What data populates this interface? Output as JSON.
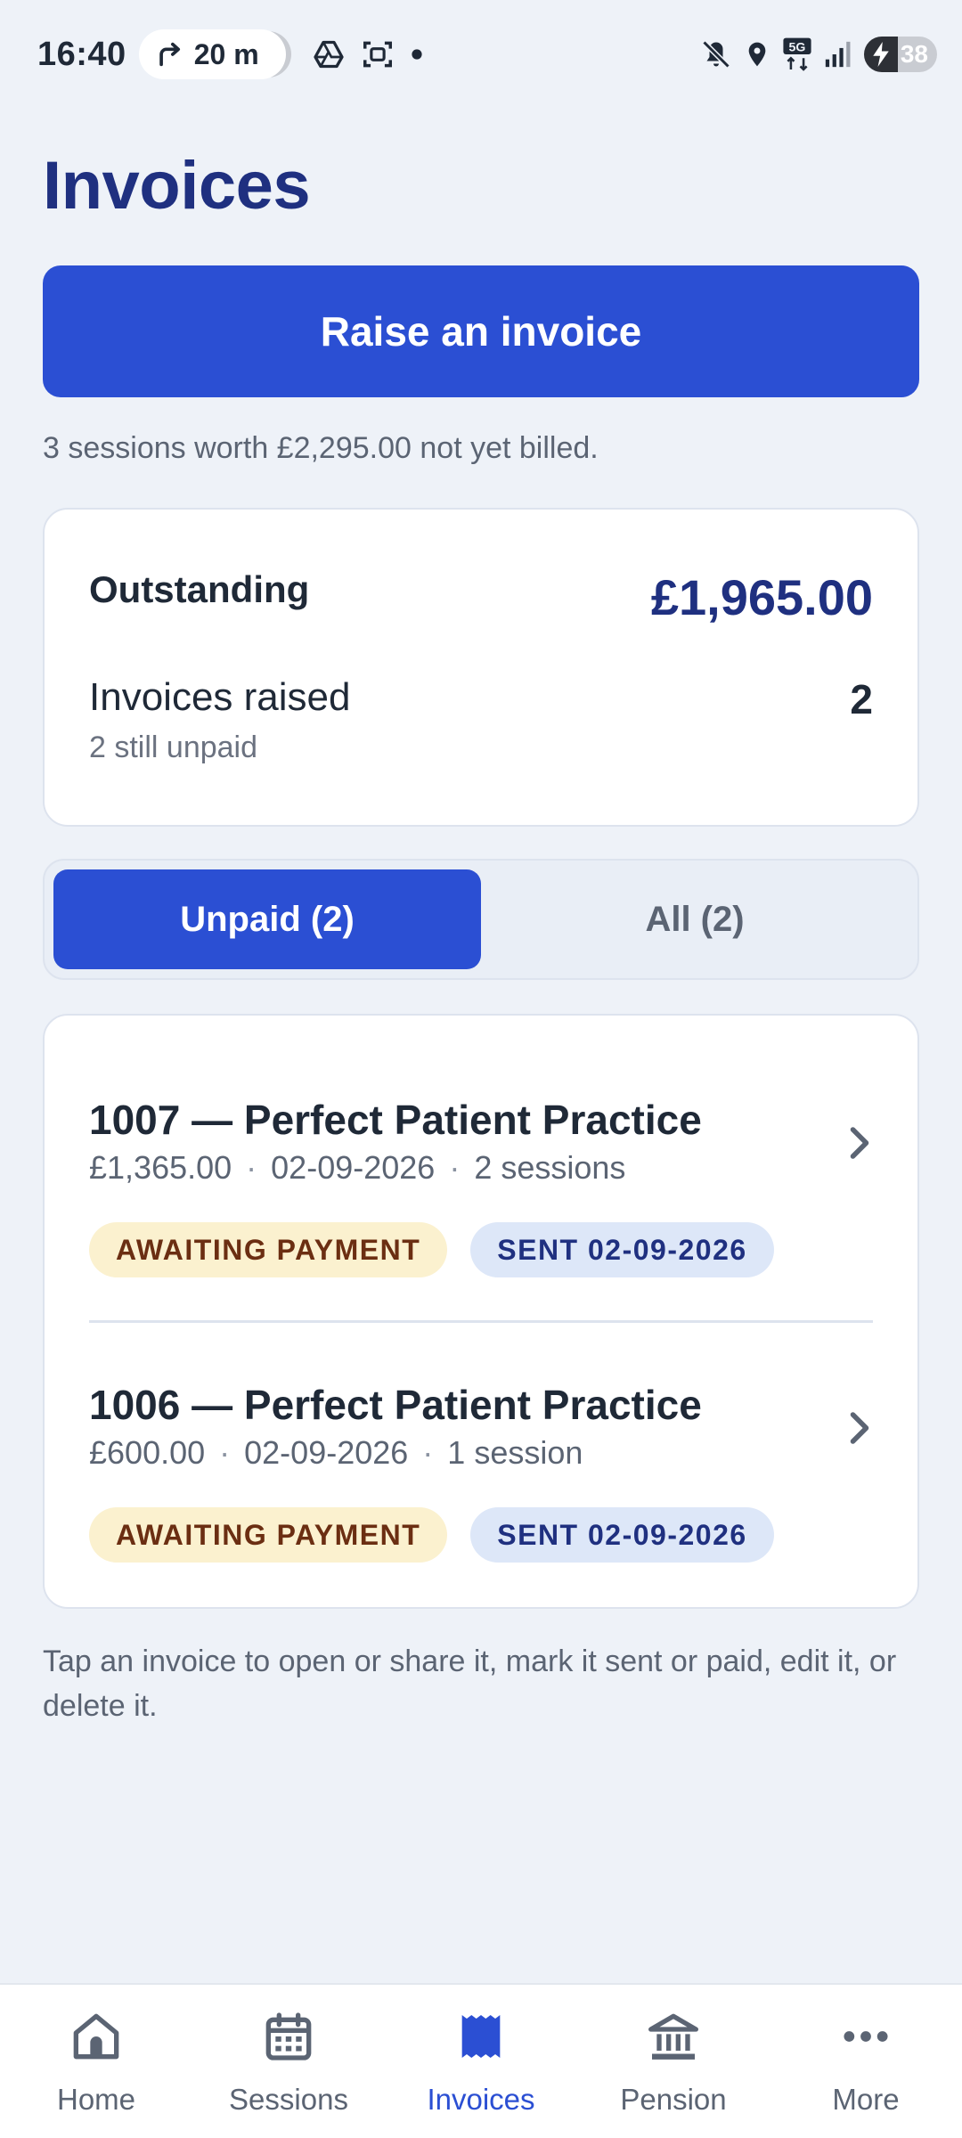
{
  "status_bar": {
    "time": "16:40",
    "timer": "20 m",
    "network": "5G",
    "battery": "38"
  },
  "page": {
    "title": "Invoices",
    "raise_button": "Raise an invoice",
    "unbilled_note": "3 sessions worth £2,295.00 not yet billed."
  },
  "summary": {
    "outstanding_label": "Outstanding",
    "outstanding_value": "£1,965.00",
    "raised_label": "Invoices raised",
    "raised_value": "2",
    "raised_sub": "2 still unpaid"
  },
  "filter": {
    "tabs": [
      {
        "label": "Unpaid (2)",
        "active": true
      },
      {
        "label": "All (2)",
        "active": false
      }
    ]
  },
  "invoices": [
    {
      "title": "1007 — Perfect Patient Practice",
      "amount": "£1,365.00",
      "date": "02-09-2026",
      "sessions": "2 sessions",
      "status": "AWAITING PAYMENT",
      "sent": "SENT 02-09-2026"
    },
    {
      "title": "1006 — Perfect Patient Practice",
      "amount": "£600.00",
      "date": "02-09-2026",
      "sessions": "1 session",
      "status": "AWAITING PAYMENT",
      "sent": "SENT 02-09-2026"
    }
  ],
  "hint": "Tap an invoice to open or share it, mark it sent or paid, edit it, or delete it.",
  "meta_separator": "·",
  "nav": {
    "items": [
      {
        "label": "Home",
        "icon": "home-icon"
      },
      {
        "label": "Sessions",
        "icon": "calendar-icon"
      },
      {
        "label": "Invoices",
        "icon": "receipt-icon",
        "active": true
      },
      {
        "label": "Pension",
        "icon": "bank-icon"
      },
      {
        "label": "More",
        "icon": "more-icon"
      }
    ]
  },
  "colors": {
    "primary": "#2b4fd3",
    "title": "#1f3080",
    "background": "#eef2f8",
    "awaiting_bg": "#fbf1cf",
    "sent_bg": "#dde7f8"
  }
}
